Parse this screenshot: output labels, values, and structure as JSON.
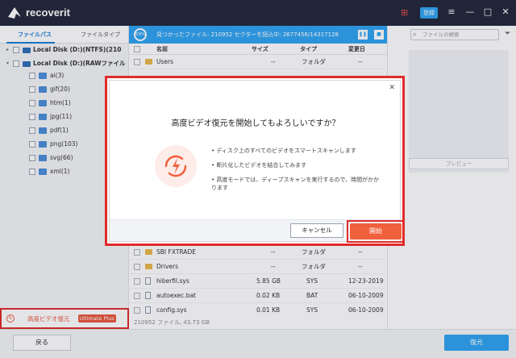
{
  "app": {
    "brand": "recoverit",
    "login": "登録"
  },
  "sidebar": {
    "tab_path": "ファイルパス",
    "tab_type": "ファイルタイプ",
    "drives": [
      "Local Disk (D:)(NTFS)(210",
      "Local Disk (D:)(RAWファイル"
    ],
    "types": [
      "ai(3)",
      "gif(20)",
      "htm(1)",
      "jpg(11)",
      "pdf(1)",
      "png(103)",
      "svg(66)",
      "xml(1)"
    ],
    "video_label": "高度ビデオ復元",
    "video_badge": "Ultimate Plus"
  },
  "scan": {
    "percent": "59%",
    "text": "見つかったファイル: 210952 セクターを読込中: 2677456/143171289"
  },
  "search": {
    "placeholder": "ファイルの検索"
  },
  "preview": {
    "button": "プレビュー"
  },
  "list": {
    "headers": {
      "name": "名前",
      "size": "サイズ",
      "type": "タイプ",
      "date": "変更日"
    },
    "top_rows": [
      {
        "name": "Users",
        "size": "--",
        "type": "フォルダ",
        "date": "--"
      }
    ],
    "rows": [
      {
        "name": "SBI FXTRADE",
        "size": "--",
        "type": "フォルダ",
        "date": "--",
        "kind": "folder"
      },
      {
        "name": "Drivers",
        "size": "--",
        "type": "フォルダ",
        "date": "--",
        "kind": "folder"
      },
      {
        "name": "hiberfil.sys",
        "size": "5.85  GB",
        "type": "SYS",
        "date": "12-23-2019",
        "kind": "file"
      },
      {
        "name": "autoexec.bat",
        "size": "0.02  KB",
        "type": "BAT",
        "date": "06-10-2009",
        "kind": "file"
      },
      {
        "name": "config.sys",
        "size": "0.01  KB",
        "type": "SYS",
        "date": "06-10-2009",
        "kind": "file"
      }
    ],
    "footer": "210952 ファイル, 43.73  GB"
  },
  "bottom": {
    "back": "戻る",
    "recover": "復元"
  },
  "dialog": {
    "title": "高度ビデオ復元を開始してもよろしいですか？",
    "bullets": [
      "• ディスク上のすべてのビデオをスマートスキャンします",
      "• 断片化したビデオを結合してみます",
      "• 高度モードでは、ディープスキャンを実行するので、時間がかかります"
    ],
    "cancel": "キャンセル",
    "start": "開始"
  },
  "colors": {
    "accent": "#2ea3f2",
    "danger": "#e02a2a",
    "orange": "#f0603d",
    "titlebar": "#21263a"
  }
}
